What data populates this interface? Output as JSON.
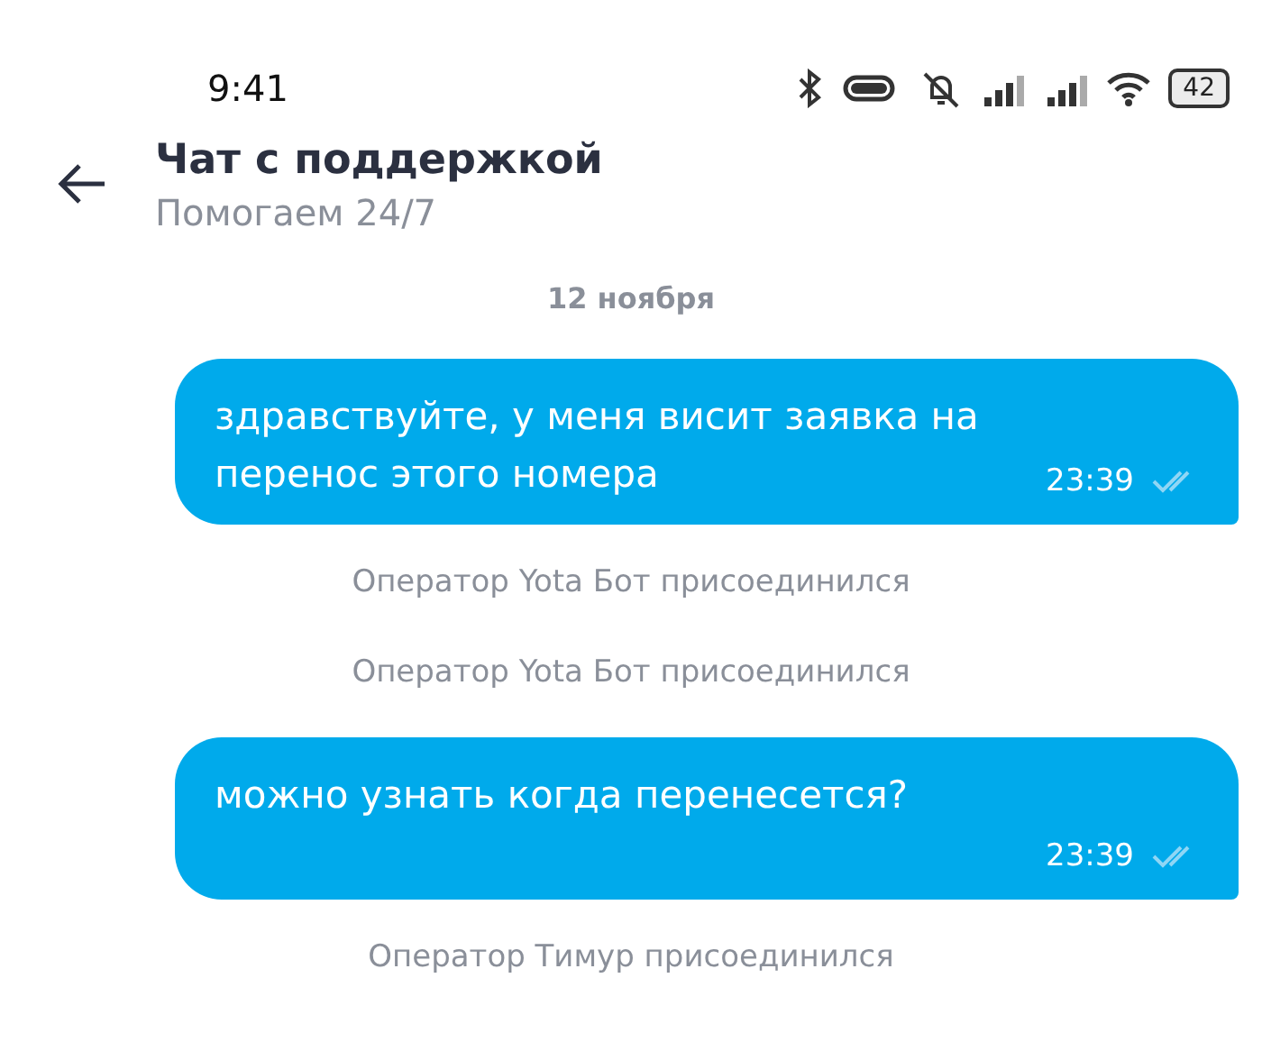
{
  "status_bar": {
    "time": "9:41",
    "battery": "42"
  },
  "header": {
    "title": "Чат с поддержкой",
    "subtitle": "Помогаем 24/7"
  },
  "date_divider": "12 ноября",
  "messages": [
    {
      "kind": "outgoing",
      "text": "здравствуйте, у меня висит заявка на перенос этого номера",
      "time": "23:39",
      "read": true
    },
    {
      "kind": "system",
      "text": "Оператор Yota Бот присоединился"
    },
    {
      "kind": "system",
      "text": "Оператор Yota Бот присоединился"
    },
    {
      "kind": "outgoing",
      "text": "можно узнать когда перенесется?",
      "time": "23:39",
      "read": true
    },
    {
      "kind": "system",
      "text": "Оператор Тимур присоединился"
    }
  ]
}
